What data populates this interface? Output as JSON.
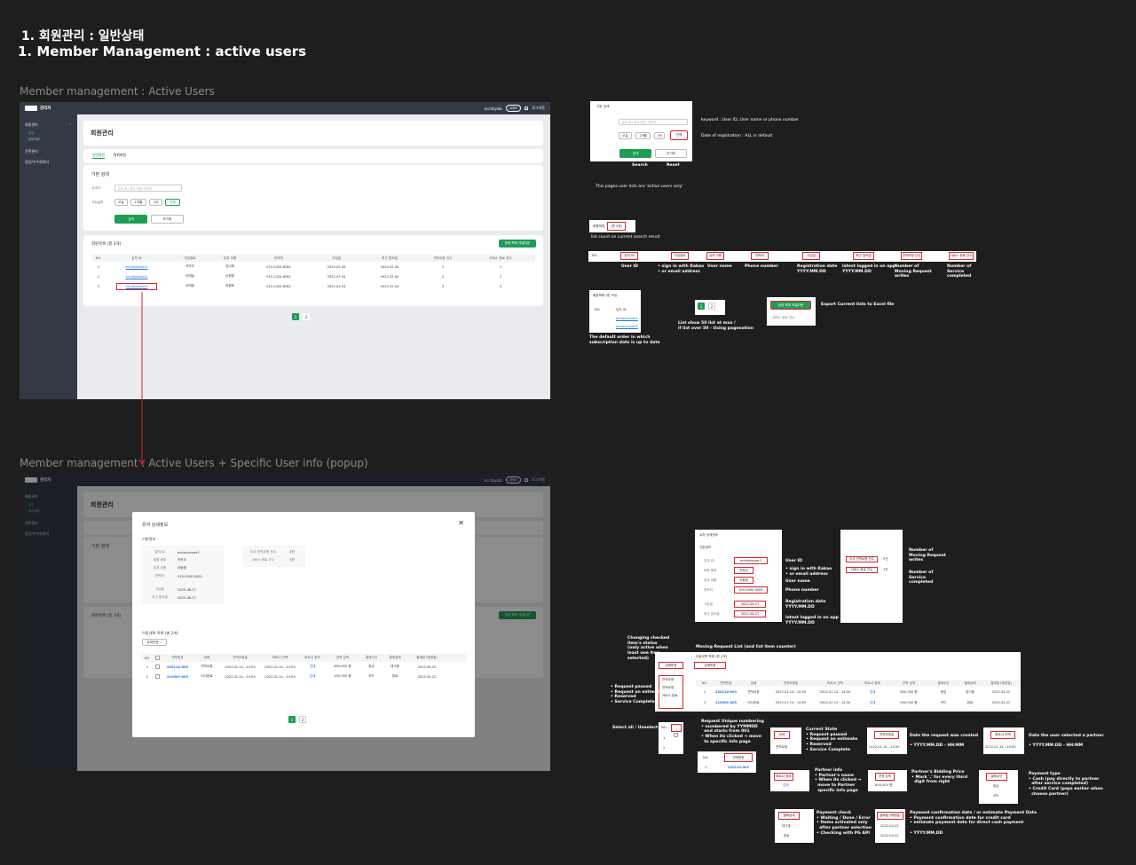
{
  "page": {
    "title_kr": "1. 회원관리 : 일반상태",
    "title_en": "1. Member Management : active users",
    "section1": "Member management : Active Users",
    "section2": "Member management : Active Users + Specific User info (popup)"
  },
  "app": {
    "brand": "관리자",
    "username": "ecclaiyola",
    "myinfo": "내정보",
    "logout": "로그아웃",
    "sidebar": {
      "member_mgmt": "회원관리",
      "general": "일반",
      "withdrawn": "탈퇴회원",
      "estimate_mgmt": "견적관리",
      "settlement": "정산/수수료관리"
    },
    "page_title": "회원관리",
    "tabs": [
      "일반회원",
      "탈퇴회원"
    ],
    "search": {
      "title": "기본 검색",
      "keyword_label": "검색어",
      "keyword_placeholder": "유저 ID / 유저 이름 / 연락처",
      "date_label": "가입날짜",
      "date_options": [
        "오늘",
        "1개월",
        "1년",
        "전체"
      ],
      "search_btn": "검색",
      "reset_btn": "초기화"
    },
    "list": {
      "title": "회원목록 (총 3개)",
      "excel_btn": "현재 목록 엑셀다운",
      "columns": [
        "NO.",
        "유저 ID",
        "가입경로",
        "유저 이름",
        "연락처",
        "가입일",
        "최근 접속일",
        "견적요청 건수",
        "서비스 완료 건수"
      ],
      "rows": [
        [
          "1",
          "ecclaiyouser1",
          "카카오",
          "김나래",
          "010-2424-8282",
          "2022.02.04",
          "2022.02.04",
          "1",
          "1"
        ],
        [
          "2",
          "ecclaiyouser2",
          "이메일",
          "이현환",
          "010-2424-8282",
          "2022.02.04",
          "2022.02.04",
          "2",
          "2"
        ],
        [
          "3",
          "ecclaiyouser3",
          "이메일",
          "최원희",
          "010-2424-8282",
          "2022.02.04",
          "2022.02.04",
          "3",
          "3"
        ]
      ],
      "pages": [
        "1",
        "2"
      ]
    }
  },
  "popup": {
    "title": "유저 상세정보",
    "basic_info": "기본정보",
    "fields": [
      {
        "label": "유저 ID",
        "value": "ecclaiyouser1"
      },
      {
        "label": "회원 종류",
        "value": "카카오"
      },
      {
        "label": "유저 이름",
        "value": "이동환"
      },
      {
        "label": "연락처",
        "value": "010-0000-0000"
      },
      {
        "label": "가입일",
        "value": "2022-06-27"
      },
      {
        "label": "최근 접속일",
        "value": "2022-06-27"
      }
    ],
    "counts": [
      {
        "label": "이사 견적요청 건수",
        "value": "2건"
      },
      {
        "label": "서비스 완료 건수",
        "value": "1건"
      }
    ],
    "moving_title": "이동내역 목록 (총 2개)",
    "status_select": "상태변경",
    "moving_columns": [
      "NO.",
      "견적번호",
      "상태",
      "견적요청일",
      "파트너 선택",
      "파트너 정보",
      "견적 금액",
      "결제수단",
      "결제상태",
      "결제일 (예정일)"
    ],
    "moving_rows": [
      [
        "1",
        "220114-003",
        "견적요청",
        "2022.01.14 - 14:50",
        "2022.01.14 - 14:50",
        "업체",
        "850,000 원",
        "현금",
        "대기중",
        "2022.04.22"
      ],
      [
        "2",
        "210501-003",
        "이사완료",
        "2022.01.14 - 14:50",
        "2022.01.14 - 14:50",
        "업체",
        "450,000 원",
        "카드",
        "완료",
        "2022.04.22"
      ]
    ],
    "pages": [
      "1",
      "2"
    ]
  },
  "annotations": {
    "search_card": {
      "title": "기본 검색",
      "keyword": "keyword : User ID, User name or phone number",
      "date": "Date of registration : ALL is default",
      "search": "Search",
      "reset": "Reset",
      "note": "This pages user lists are 'active users only'"
    },
    "list_count": {
      "label": "회원목록",
      "count": "(총 3개)",
      "note": "list count on current search result"
    },
    "columns": [
      {
        "head": "유저 ID",
        "desc": "User ID"
      },
      {
        "head": "가입경로",
        "desc": "• sign in with Kakao\n• or email address"
      },
      {
        "head": "유저 이름",
        "desc": "User name"
      },
      {
        "head": "연락처",
        "desc": "Phone number"
      },
      {
        "head": "가입일",
        "desc": "Registration date\nYYYY.MM.DD"
      },
      {
        "head": "최근 접속일",
        "desc": "latest logged in on app\nYYYY.MM.DD"
      },
      {
        "head": "견적요청 건수",
        "desc": "Number of\nMoving Request\nwrites"
      },
      {
        "head": "서비스 완료 건수",
        "desc": "Number of\nService\ncompleted"
      }
    ],
    "order_note": "The default order in which\nsubscription date is up to date",
    "pagination_note": "List show 50 list at max /\nif list over 50 - Using pagenation",
    "excel_note": "Export Current lists to Excel file",
    "excel_sub": "서비스 완료 건수",
    "user_info": {
      "id": "User ID",
      "kakao": "• sign in with Kakao\n• or email address",
      "name": "User name",
      "phone": "Phone number",
      "reg": "Registration date\nYYYY.MM.DD",
      "latest": "latest logged in on app\nYYYY.MM.DD"
    },
    "counts_note": {
      "moving": "Number of\nMoving Request\nwrites",
      "service": "Number of\nService\ncompleted"
    },
    "changing_status": "Changing checked\nitem's status\n(only active when\nleast one item\nselected)",
    "moving_list_note": "Moving Request List (and list item counter)",
    "status_options": [
      "견적요청",
      "견적요청",
      "서비스 완료"
    ],
    "status_list": "• Request paused\n• Request an estimate\n• Reserved\n• Service Complete",
    "select_all": "Select all / Unselect all",
    "request_no": "Request Unique numbering\n• numbered by YYMMDD\n  and starts from 001\n• When its clicked → move\n  to specific info page",
    "current_state": "Current State\n• Request paused\n• Request an estimate\n• Reserved\n• Service Complete",
    "req_date": "Date the request was created\n\n• YYYY.MM.DD - HH:MM",
    "partner_date": "Date the user selected a partner\n\n• YYYY.MM.DD - HH:MM",
    "partner_info": "Partner info\n• Partner's name\n• When its clicked →\n  move to Partner\n  specific info page",
    "bidding": "Partner's Bidding Price\n• Mark ',' for every third\n  digit from right",
    "payment_type": "Payment type\n• Cash (pay directly to partner\n  after service completed)\n• Credit Card (pays earlier when\n  choose partner)",
    "payment_check": "Payment check\n• Waiting / Done / Error\n• Items activated only\n  after partner selection\n• Checking with PG API",
    "payment_date": "Payment confirmation date / or estimate Payment Date\n• Payment confirmation date for credit card\n• estimate payment date for direct cash payment\n\n• YYYY.MM.DD"
  }
}
